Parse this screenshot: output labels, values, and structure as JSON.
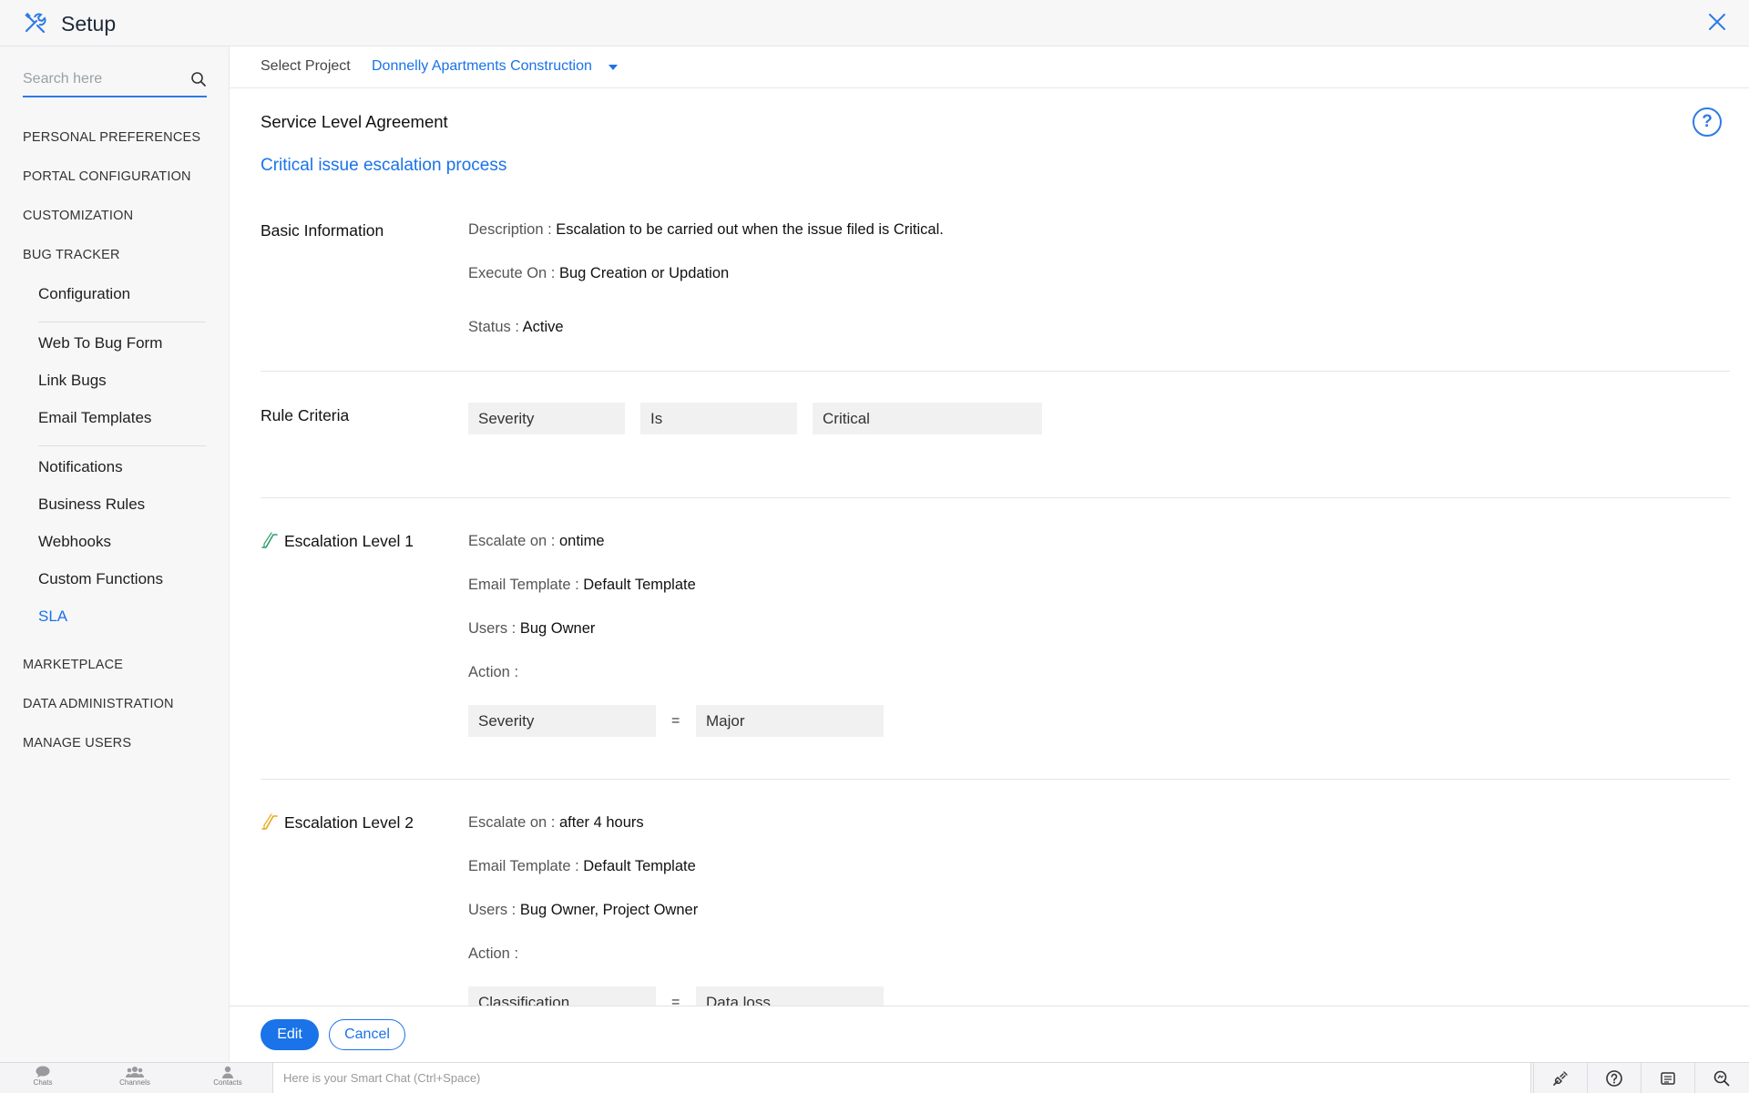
{
  "app": {
    "title": "Setup"
  },
  "sidebar": {
    "search_placeholder": "Search here",
    "sections": {
      "personal_preferences": "PERSONAL PREFERENCES",
      "portal_configuration": "PORTAL CONFIGURATION",
      "customization": "CUSTOMIZATION",
      "bug_tracker": "BUG TRACKER",
      "marketplace": "MARKETPLACE",
      "data_administration": "DATA ADMINISTRATION",
      "manage_users": "MANAGE USERS"
    },
    "bug_tracker_items": [
      {
        "label": "Configuration"
      },
      {
        "label": "Web To Bug Form"
      },
      {
        "label": "Link Bugs"
      },
      {
        "label": "Email Templates"
      },
      {
        "label": "Notifications"
      },
      {
        "label": "Business Rules"
      },
      {
        "label": "Webhooks"
      },
      {
        "label": "Custom Functions"
      },
      {
        "label": "SLA",
        "active": true
      }
    ]
  },
  "project": {
    "label": "Select Project",
    "value": "Donnelly Apartments Construction"
  },
  "main": {
    "page_title": "Service Level Agreement",
    "help": "?",
    "sla_name": "Critical issue escalation process",
    "basic_info": {
      "label": "Basic Information",
      "description_key": "Description :",
      "description_val": "Escalation to be carried out when the issue filed is Critical.",
      "execute_key": "Execute On :",
      "execute_val": "Bug Creation or Updation",
      "status_key": "Status :",
      "status_val": "Active"
    },
    "rule_criteria": {
      "label": "Rule Criteria",
      "field": "Severity",
      "operator": "Is",
      "value": "Critical"
    },
    "levels": [
      {
        "label": "Escalation Level 1",
        "icon_color": "#2e9e6b",
        "escalate_key": "Escalate on :",
        "escalate_val": "ontime",
        "template_key": "Email Template :",
        "template_val": "Default Template",
        "users_key": "Users :",
        "users_val": "Bug Owner",
        "action_key": "Action :",
        "action_field": "Severity",
        "action_eq": "=",
        "action_value": "Major"
      },
      {
        "label": "Escalation Level 2",
        "icon_color": "#e6a817",
        "escalate_key": "Escalate on :",
        "escalate_val": "after 4 hours",
        "template_key": "Email Template :",
        "template_val": "Default Template",
        "users_key": "Users :",
        "users_val": "Bug Owner, Project Owner",
        "action_key": "Action :",
        "action_field": "Classification",
        "action_eq": "=",
        "action_value": "Data loss"
      }
    ]
  },
  "actions": {
    "edit": "Edit",
    "cancel": "Cancel"
  },
  "bottombar": {
    "tabs": [
      "Chats",
      "Channels",
      "Contacts"
    ],
    "chat_placeholder": "Here is your Smart Chat (Ctrl+Space)",
    "icons": [
      "plug-icon",
      "help-circle-icon",
      "newspaper-icon",
      "search-zoom-icon"
    ]
  },
  "colors": {
    "accent": "#1a73e8"
  }
}
